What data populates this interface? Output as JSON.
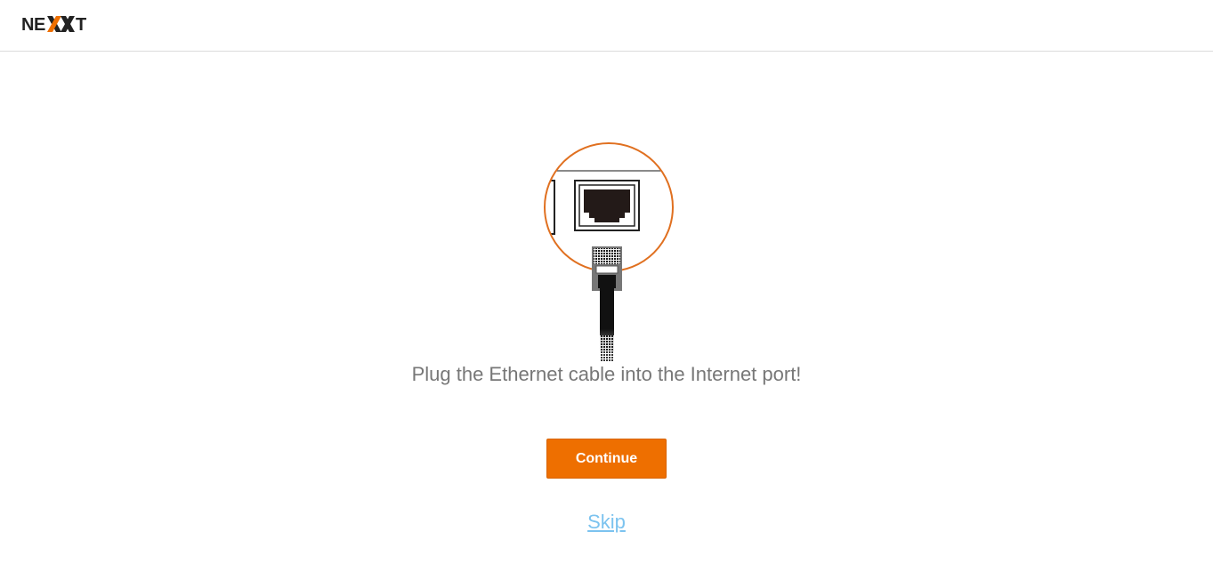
{
  "header": {
    "logo_text": "NEXXT",
    "brand_color": "#ee6f00"
  },
  "main": {
    "illustration_icon": "ethernet-port-cable-icon",
    "message": "Plug the Ethernet cable into the Internet port!",
    "continue_label": "Continue",
    "skip_label": "Skip"
  },
  "colors": {
    "accent": "#ee6f00",
    "link": "#7cc3ef",
    "text": "#777777"
  }
}
